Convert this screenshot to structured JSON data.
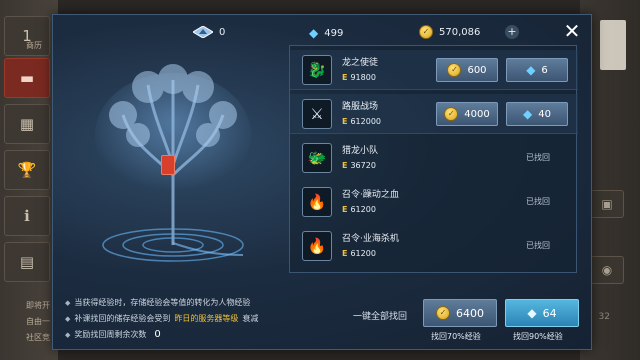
{
  "background": {
    "tabs": [
      "1",
      "",
      "",
      "",
      "",
      ""
    ],
    "left_label": "商历",
    "left_footer_1": "即将开",
    "left_footer_2": "自由一",
    "left_footer_3": "社区竞",
    "right_number": "32"
  },
  "header": {
    "currency_1": {
      "icon": "blue-triangle-icon",
      "value": "0"
    },
    "currency_2": {
      "icon": "diamond-icon",
      "value": "499"
    },
    "currency_3": {
      "icon": "gold-coin-icon",
      "value": "570,086"
    },
    "plus_symbol": "+",
    "close_symbol": "✕"
  },
  "rows": [
    {
      "name": "龙之使徒",
      "exp": "91800",
      "icon": "dragon-emblem-icon",
      "status": "",
      "gold": "600",
      "diamond": "6"
    },
    {
      "name": "路服战场",
      "exp": "612000",
      "icon": "battlefield-icon",
      "status": "",
      "gold": "4000",
      "diamond": "40"
    },
    {
      "name": "猎龙小队",
      "exp": "36720",
      "icon": "dragon-hunt-icon",
      "status": "已找回"
    },
    {
      "name": "召令·躁动之血",
      "exp": "61200",
      "icon": "summon-blood-icon",
      "status": "已找回"
    },
    {
      "name": "召令·业海杀机",
      "exp": "61200",
      "icon": "summon-sea-icon",
      "status": "已找回"
    }
  ],
  "info": {
    "line1": "当获得经验时，存储经验会等值的转化为人物经验",
    "line2_a": "补课找回的储存经验会受到",
    "line2_hl": "昨日的服务器等级",
    "line2_b": "衰减",
    "line3": "奖励找回周剩余次数",
    "line3_num": "0"
  },
  "footer": {
    "all_label": "一键全部找回",
    "gold_value": "6400",
    "gold_caption": "找回70%经验",
    "diamond_value": "64",
    "diamond_caption": "找回90%经验"
  },
  "colors": {
    "accent_gold": "#f0c23c",
    "accent_blue": "#2c83b6",
    "diamond": "#6fd0ff"
  }
}
